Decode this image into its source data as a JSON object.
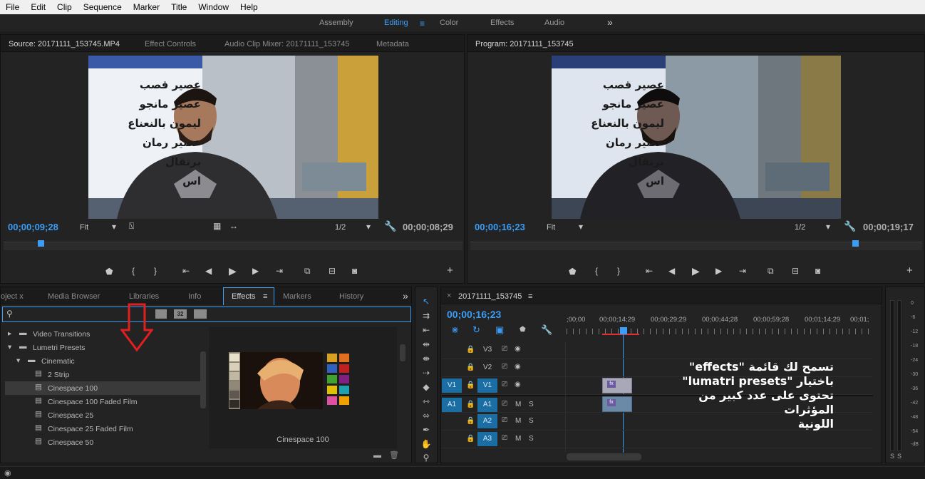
{
  "menu": [
    "File",
    "Edit",
    "Clip",
    "Sequence",
    "Marker",
    "Title",
    "Window",
    "Help"
  ],
  "workspaces": {
    "assembly": "Assembly",
    "editing": "Editing",
    "color": "Color",
    "effects": "Effects",
    "audio": "Audio",
    "more": "»"
  },
  "source": {
    "tabs": [
      "Source: 20171111_153745.MP4",
      "Effect Controls",
      "Audio Clip Mixer: 20171111_153745",
      "Metadata"
    ],
    "timecode_current": "00;00;09;28",
    "timecode_duration": "00;00;08;29",
    "fit": "Fit",
    "resolution": "1/2",
    "playhead_fraction": 0.075
  },
  "program": {
    "tab": "Program: 20171111_153745",
    "timecode_current": "00;00;16;23",
    "timecode_duration": "00;00;19;17",
    "fit": "Fit",
    "resolution": "1/2",
    "playhead_fraction": 0.845
  },
  "sign_lines": [
    "عصير قصب",
    "عصير مانجو",
    "ليمون بالنعناع",
    "عصير رمان",
    "برتقال",
    "اس"
  ],
  "effects_panel": {
    "tabs": [
      "oject x",
      "Media Browser",
      "Libraries",
      "Info",
      "Effects",
      "Markers",
      "History"
    ],
    "more": "»",
    "filter_icons": [
      "32"
    ],
    "tree": [
      {
        "label": "Video Transitions",
        "level": 0,
        "expanded": false
      },
      {
        "label": "Lumetri Presets",
        "level": 0,
        "expanded": true
      },
      {
        "label": "Cinematic",
        "level": 1,
        "expanded": true
      },
      {
        "label": "2 Strip",
        "level": 2
      },
      {
        "label": "Cinespace 100",
        "level": 2,
        "selected": true
      },
      {
        "label": "Cinespace 100 Faded Film",
        "level": 2
      },
      {
        "label": "Cinespace 25",
        "level": 2
      },
      {
        "label": "Cinespace 25 Faded Film",
        "level": 2
      },
      {
        "label": "Cinespace 50",
        "level": 2
      }
    ],
    "preview_label": "Cinespace 100"
  },
  "timeline": {
    "tab": "20171111_153745",
    "timecode": "00;00;16;23",
    "ruler": [
      ";00;00",
      "00;00;14;29",
      "00;00;29;29",
      "00;00;44;28",
      "00;00;59;28",
      "00;01;14;29",
      "00;01;"
    ],
    "tracks": [
      {
        "name": "V3",
        "src": "",
        "type": "video"
      },
      {
        "name": "V2",
        "src": "",
        "type": "video"
      },
      {
        "name": "V1",
        "src": "V1",
        "type": "video"
      },
      {
        "name": "A1",
        "src": "A1",
        "type": "audio"
      },
      {
        "name": "A2",
        "src": "",
        "type": "audio"
      },
      {
        "name": "A3",
        "src": "",
        "type": "audio"
      }
    ],
    "m": "M",
    "s": "S",
    "fx": "fx"
  },
  "overlay_text": {
    "line1": "تسمح لك قائمة \"effects\"",
    "line2": "باختيار \"lumatri presets\"",
    "line3": "تحتوى على عدد كبير من المؤثرات",
    "line4": "اللونية"
  },
  "meter": {
    "labels": [
      "0",
      "-6",
      "-12",
      "-18",
      "-24",
      "-30",
      "-36",
      "-42",
      "-48",
      "-54",
      "-dB"
    ],
    "s": "S"
  },
  "colors": {
    "accent": "#3b9df5",
    "panel": "#232323",
    "track_on": "#1b6ea3",
    "arrow": "#e02020"
  }
}
